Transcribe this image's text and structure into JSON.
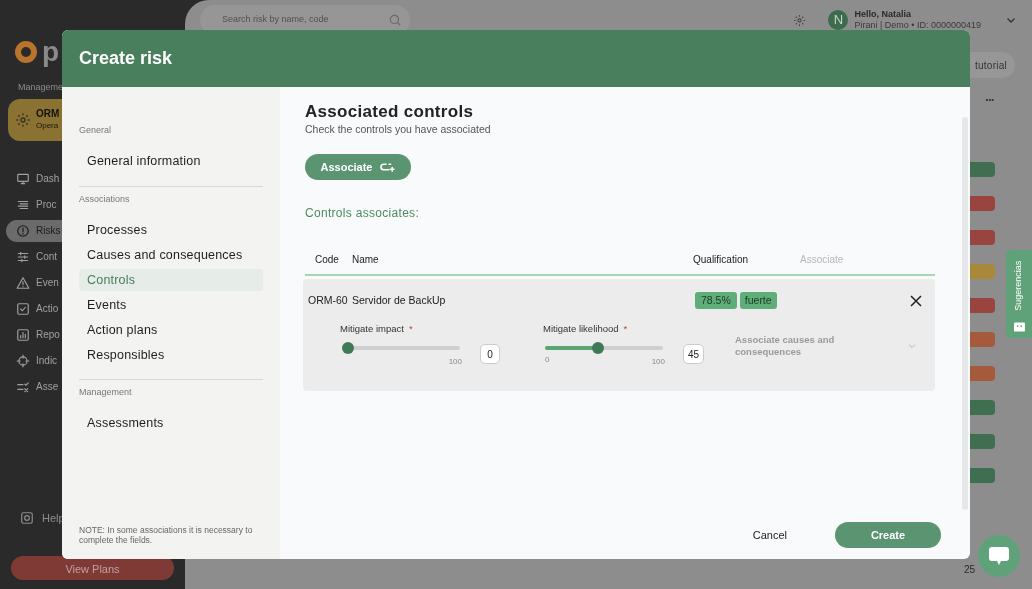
{
  "app": {
    "logo_text": "p",
    "section_label": "Manageme",
    "module": {
      "title": "ORM",
      "subtitle": "Opera"
    },
    "nav": [
      {
        "label": "Dash",
        "selected": false
      },
      {
        "label": "Proc",
        "selected": false
      },
      {
        "label": "Risks",
        "selected": true
      },
      {
        "label": "Cont",
        "selected": false
      },
      {
        "label": "Even",
        "selected": false
      },
      {
        "label": "Actio",
        "selected": false
      },
      {
        "label": "Repo",
        "selected": false
      },
      {
        "label": "Indic",
        "selected": false
      },
      {
        "label": "Asse",
        "selected": false
      }
    ],
    "help": "Help",
    "plans_button": "View Plans",
    "search": {
      "placeholder": "Search risk by name, code"
    },
    "user": {
      "initial": "N",
      "greeting": "Hello, Natalia",
      "detail": "Pirani | Demo • ID: 0000000419"
    },
    "tutorial_button": "tutorial",
    "more": "•••",
    "status_bars": [
      {
        "color": "#3f6e50"
      },
      {
        "color": "#9a4440"
      },
      {
        "color": "#9a4440"
      },
      {
        "color": "#a8893a"
      },
      {
        "color": "#9a4440"
      },
      {
        "color": "#a65a3c"
      },
      {
        "color": "#a65a3c"
      },
      {
        "color": "#3f6e50"
      },
      {
        "color": "#3f6e50"
      },
      {
        "color": "#3f6e50"
      }
    ],
    "page_count": "25",
    "suggestions_tab": "Sugerencias"
  },
  "modal": {
    "title": "Create risk",
    "sections": [
      {
        "heading": "General",
        "items": [
          {
            "label": "General information",
            "selected": false
          }
        ]
      },
      {
        "heading": "Associations",
        "items": [
          {
            "label": "Processes",
            "selected": false
          },
          {
            "label": "Causes and consequences",
            "selected": false
          },
          {
            "label": "Controls",
            "selected": true
          },
          {
            "label": "Events",
            "selected": false
          },
          {
            "label": "Action plans",
            "selected": false
          },
          {
            "label": "Responsibles",
            "selected": false
          }
        ]
      },
      {
        "heading": "Management",
        "items": [
          {
            "label": "Assessments",
            "selected": false
          }
        ]
      }
    ],
    "note": "NOTE: In some associations it is necessary to complete the fields.",
    "content": {
      "title": "Associated controls",
      "subtitle": "Check the controls you have associated",
      "associate_button": "Associate",
      "list_title": "Controls associates:",
      "table": {
        "columns": [
          "Code",
          "Name",
          "Qualification",
          "Associate"
        ],
        "rows": [
          {
            "code": "ORM-60",
            "name": "Servidor de BackUp",
            "score": "78.5%",
            "rating": "fuerte",
            "sliders": [
              {
                "label": "Mitigate impact",
                "required": "*",
                "level": 0,
                "max_label": "100",
                "reading": "0"
              },
              {
                "label": "Mitigate likelihood",
                "required": "*",
                "level": 0.45,
                "min_label": "0",
                "max_label": "100",
                "reading": "45"
              }
            ],
            "dropdown": {
              "placeholder": "Associate causes and consequences"
            }
          }
        ]
      }
    },
    "buttons": {
      "cancel": "Cancel",
      "create": "Create"
    }
  }
}
